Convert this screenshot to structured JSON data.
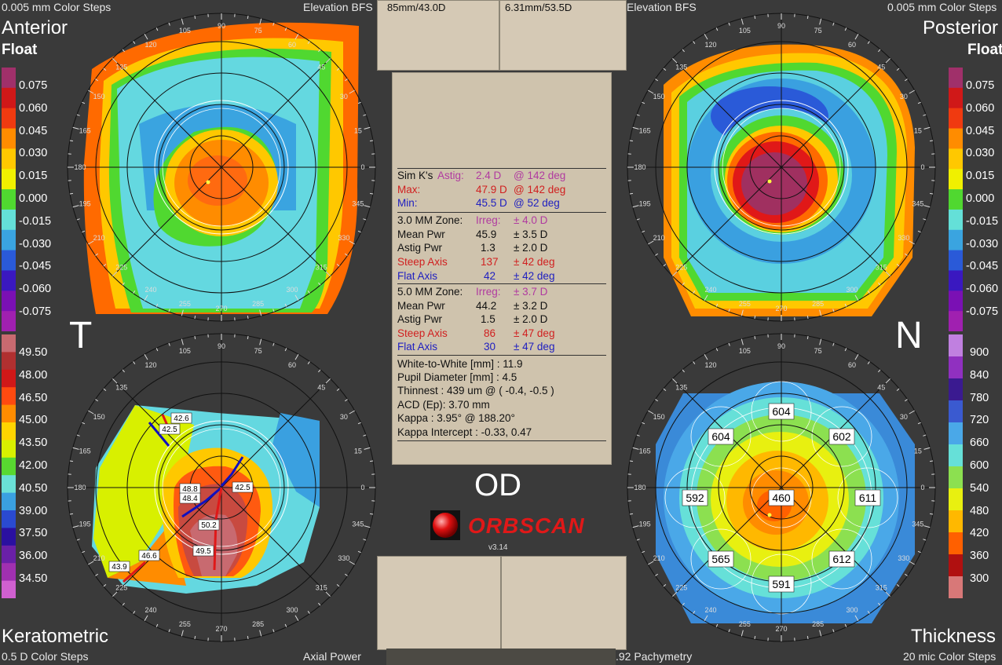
{
  "header": {
    "tl_color_steps": "0.005 mm Color Steps",
    "tl_map_type": "Elevation BFS",
    "tr_map_type": "Elevation BFS",
    "tr_color_steps": "0.005 mm Color Steps",
    "top_left_tab": "85mm/43.0D",
    "top_right_tab": "6.31mm/53.5D"
  },
  "labels": {
    "anterior": "Anterior",
    "float_left": "Float",
    "posterior": "Posterior",
    "float_right": "Float",
    "temporal": "T",
    "nasal": "N",
    "keratometric": "Keratometric",
    "thickness": "Thickness",
    "bl_color_steps": "0.5 D Color Steps",
    "bl_map_type": "Axial Power",
    "br_pachy": ".92 Pachymetry",
    "br_color_steps": "20 mic Color Steps",
    "eye": "OD",
    "brand": "ORBSCAN",
    "version": "v3.14"
  },
  "scales": {
    "float_left": [
      "0.075",
      "0.060",
      "0.045",
      "0.030",
      "0.015",
      "0.000",
      "-0.015",
      "-0.030",
      "-0.045",
      "-0.060",
      "-0.075"
    ],
    "float_right": [
      "0.075",
      "0.060",
      "0.045",
      "0.030",
      "0.015",
      "0.000",
      "-0.015",
      "-0.030",
      "-0.045",
      "-0.060",
      "-0.075"
    ],
    "kerato": [
      "49.50",
      "48.00",
      "46.50",
      "45.00",
      "43.50",
      "42.00",
      "40.50",
      "39.00",
      "37.50",
      "36.00",
      "34.50"
    ],
    "thickness": [
      "900",
      "840",
      "780",
      "720",
      "660",
      "600",
      "540",
      "480",
      "420",
      "360",
      "300"
    ]
  },
  "colors": {
    "float": [
      "#a0306a",
      "#d01818",
      "#f03a10",
      "#ff8c00",
      "#ffc800",
      "#f0f000",
      "#50d830",
      "#64e0d8",
      "#3aa4e0",
      "#2a5ad8",
      "#3a18c0",
      "#7a10b4",
      "#a020b0"
    ],
    "kerato": [
      "#c86a70",
      "#b03030",
      "#d01818",
      "#ff4a10",
      "#ff8c00",
      "#ffd400",
      "#d8f000",
      "#58d830",
      "#6ae0d6",
      "#3aa0e0",
      "#2a4ad0",
      "#2a10a0",
      "#6a20a8",
      "#a030b0",
      "#d060d0"
    ],
    "thickness": [
      "#c080e0",
      "#9030c0",
      "#3a1a90",
      "#3a5ad0",
      "#4aa8e8",
      "#66e0d8",
      "#8ce050",
      "#e8f010",
      "#ffb800",
      "#ff6000",
      "#b01010",
      "#d87878"
    ]
  },
  "degree_ticks": [
    "105",
    "90",
    "75",
    "120",
    "60",
    "135",
    "45",
    "150",
    "30",
    "165",
    "15",
    "180",
    "0",
    "195",
    "345",
    "210",
    "330",
    "225",
    "315",
    "240",
    "300",
    "255",
    "270",
    "285"
  ],
  "stats": {
    "simk_label": "Sim K's",
    "astig_label": "Astig:",
    "astig_value": "2.4 D",
    "astig_axis": "@ 142 deg",
    "max_label": "Max:",
    "max_value": "47.9 D",
    "max_axis": "@ 142 deg",
    "min_label": "Min:",
    "min_value": "45.5 D",
    "min_axis": "@ 52 deg",
    "zone3": {
      "title": "3.0 MM Zone:",
      "irreg_label": "Irreg:",
      "irreg_value": "± 4.0 D",
      "mean_label": "Mean Pwr",
      "mean_value": "45.9",
      "mean_pm": "± 3.5 D",
      "astig_label": "Astig Pwr",
      "astig_value": "1.3",
      "astig_pm": "± 2.0 D",
      "steep_label": "Steep Axis",
      "steep_value": "137",
      "steep_pm": "± 42 deg",
      "flat_label": "Flat Axis",
      "flat_value": "42",
      "flat_pm": "± 42 deg"
    },
    "zone5": {
      "title": "5.0 MM Zone:",
      "irreg_label": "Irreg:",
      "irreg_value": "± 3.7 D",
      "mean_label": "Mean Pwr",
      "mean_value": "44.2",
      "mean_pm": "± 3.2 D",
      "astig_label": "Astig Pwr",
      "astig_value": "1.5",
      "astig_pm": "± 2.0 D",
      "steep_label": "Steep Axis",
      "steep_value": "86",
      "steep_pm": "± 47 deg",
      "flat_label": "Flat Axis",
      "flat_value": "30",
      "flat_pm": "± 47 deg"
    },
    "wtw": "White-to-White [mm] : 11.9",
    "pupil": "Pupil Diameter [mm] :  4.5",
    "thinnest": "Thinnest : 439 um @ ( -0.4, -0.5 )",
    "acd": "ACD (Ep): 3.70 mm",
    "kappa": "Kappa : 3.95° @ 188.20°",
    "kappa_intercept": "Kappa Intercept : -0.33, 0.47"
  },
  "kerato_labels": [
    "42.6",
    "42.5",
    "42.5",
    "48.8",
    "48.4",
    "50.2",
    "49.5",
    "46.6",
    "43.9"
  ],
  "thickness_labels": [
    "604",
    "604",
    "602",
    "592",
    "460",
    "611",
    "565",
    "612",
    "591"
  ]
}
